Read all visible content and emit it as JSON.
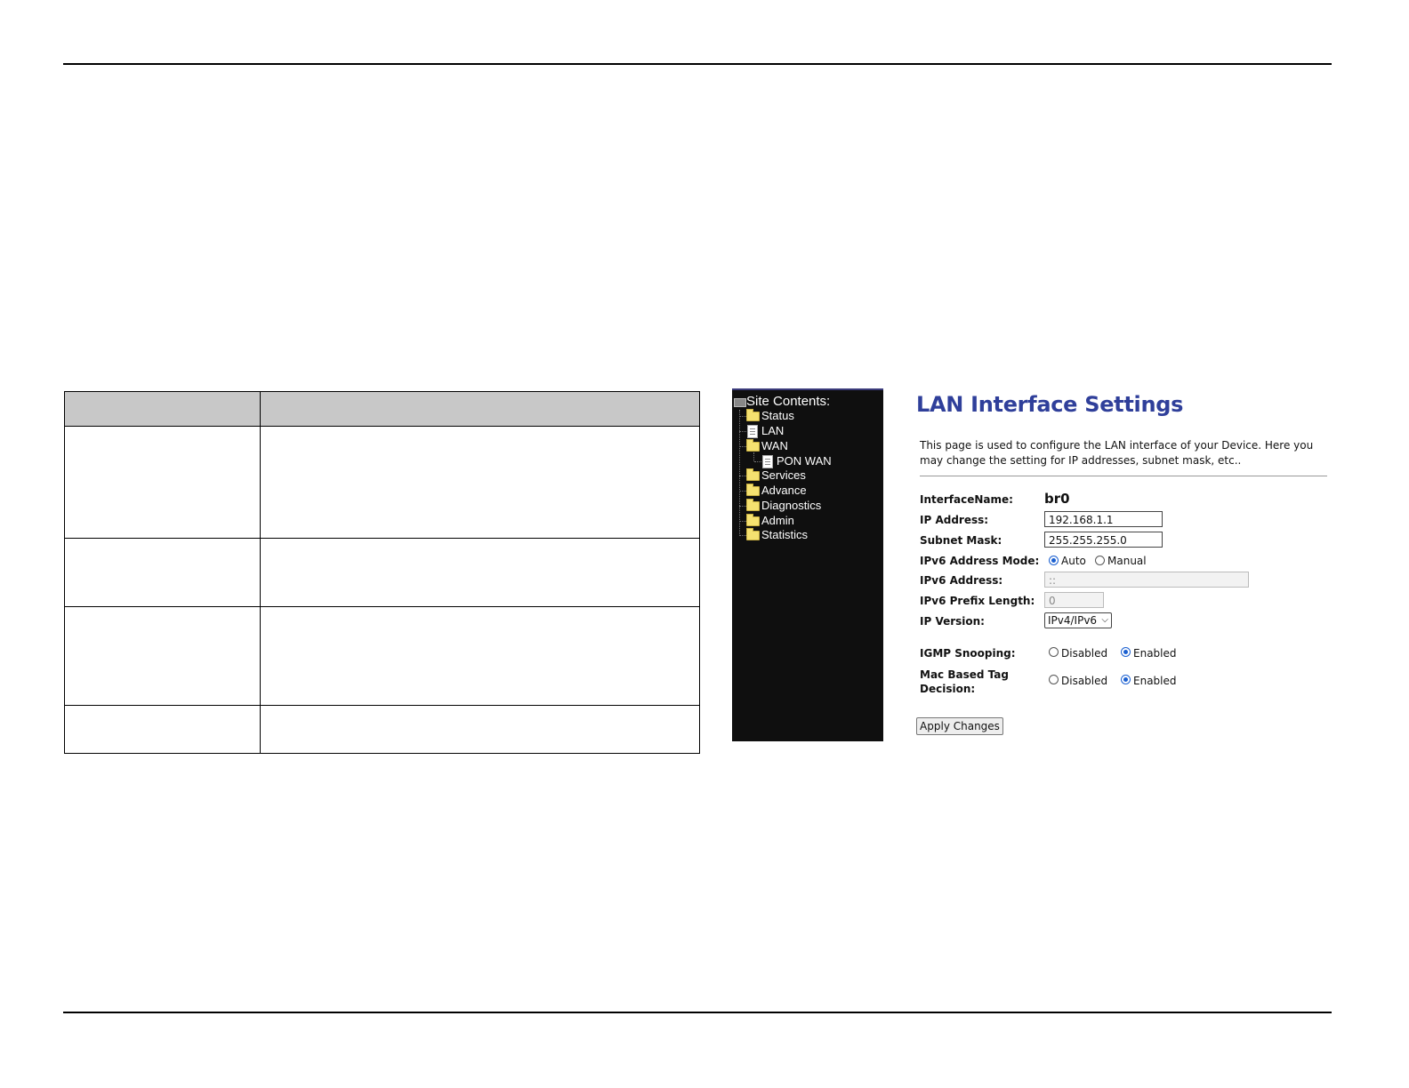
{
  "sidebar": {
    "title": "Site Contents:",
    "items": [
      {
        "label": "Status",
        "icon": "folder-icon"
      },
      {
        "label": "LAN",
        "icon": "page-icon"
      },
      {
        "label": "WAN",
        "icon": "folder-open-icon"
      },
      {
        "label": "PON WAN",
        "icon": "page-icon"
      },
      {
        "label": "Services",
        "icon": "folder-icon"
      },
      {
        "label": "Advance",
        "icon": "folder-icon"
      },
      {
        "label": "Diagnostics",
        "icon": "folder-icon"
      },
      {
        "label": "Admin",
        "icon": "folder-icon"
      },
      {
        "label": "Statistics",
        "icon": "folder-icon"
      }
    ]
  },
  "lan": {
    "title": "LAN Interface Settings",
    "description": "This page is used to configure the LAN interface of your Device. Here you may change the setting for IP addresses, subnet mask, etc..",
    "interface_name_label": "InterfaceName:",
    "interface_name_value": "br0",
    "ip_address_label": "IP Address:",
    "ip_address_value": "192.168.1.1",
    "subnet_mask_label": "Subnet Mask:",
    "subnet_mask_value": "255.255.255.0",
    "ipv6_mode_label": "IPv6 Address Mode:",
    "ipv6_mode_auto": "Auto",
    "ipv6_mode_manual": "Manual",
    "ipv6_address_label": "IPv6 Address:",
    "ipv6_address_value": "::",
    "ipv6_prefix_label": "IPv6 Prefix Length:",
    "ipv6_prefix_value": "0",
    "ip_version_label": "IP Version:",
    "ip_version_value": "IPv4/IPv6",
    "igmp_label": "IGMP Snooping:",
    "mac_tag_label_line1": "Mac Based Tag",
    "mac_tag_label_line2": "Decision:",
    "disabled_label": "Disabled",
    "enabled_label": "Enabled",
    "apply_label": "Apply Changes",
    "accent_color": "#2f3f9a"
  }
}
